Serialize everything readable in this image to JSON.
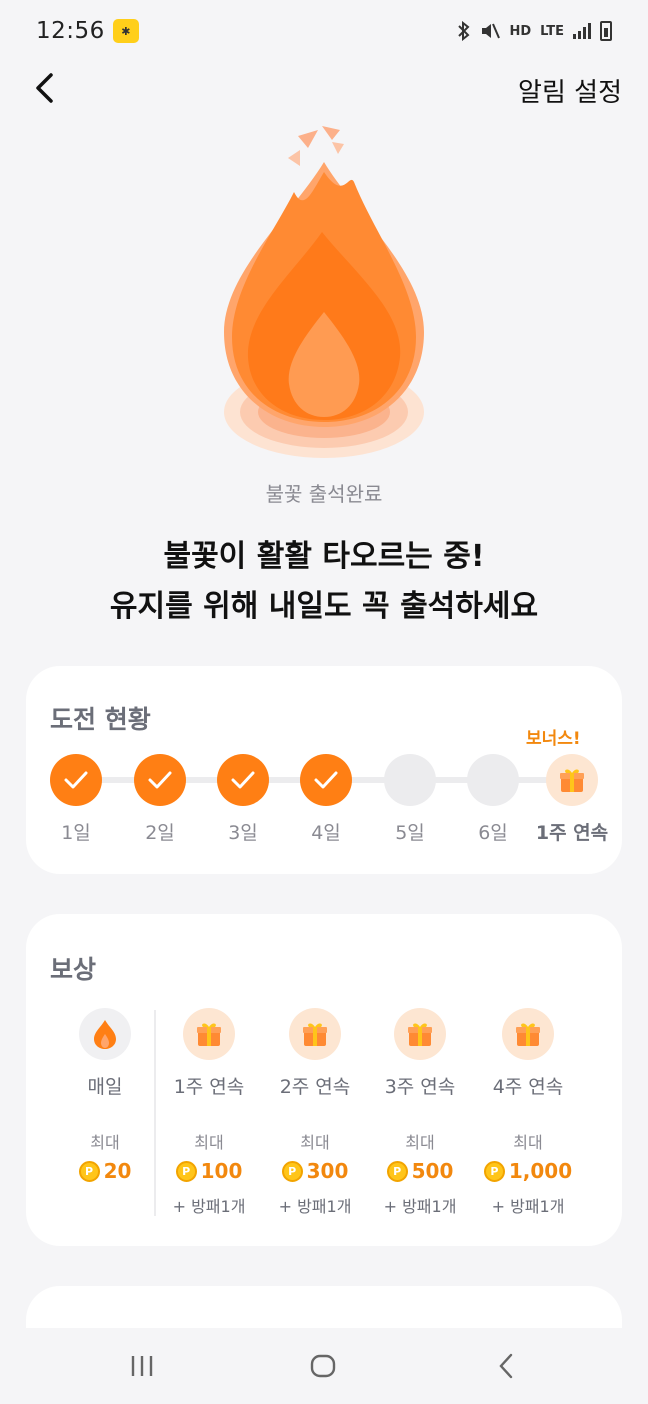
{
  "status_bar": {
    "time": "12:56",
    "indicators": [
      "bluetooth-icon",
      "mute-icon",
      "HD",
      "LTE",
      "signal-icon",
      "battery-icon"
    ],
    "hd_label": "HD",
    "lte_label": "LTE"
  },
  "nav": {
    "alarm_settings": "알림 설정"
  },
  "hero": {
    "caption": "불꽃 출석완료",
    "headline_line1": "불꽃이 활활 타오르는 중!",
    "headline_line2": "유지를 위해 내일도 꼭 출석하세요",
    "flame_color": "#ff7f14"
  },
  "challenge": {
    "title": "도전 현황",
    "bonus_label": "보너스!",
    "days": [
      {
        "label": "1일",
        "status": "done"
      },
      {
        "label": "2일",
        "status": "done"
      },
      {
        "label": "3일",
        "status": "done"
      },
      {
        "label": "4일",
        "status": "done"
      },
      {
        "label": "5일",
        "status": "todo"
      },
      {
        "label": "6일",
        "status": "todo"
      },
      {
        "label": "1주 연속",
        "status": "gift"
      }
    ]
  },
  "rewards": {
    "title": "보상",
    "items": [
      {
        "name": "매일",
        "max": "최대",
        "amount": "20",
        "extra": ""
      },
      {
        "name": "1주 연속",
        "max": "최대",
        "amount": "100",
        "extra": "+ 방패1개"
      },
      {
        "name": "2주 연속",
        "max": "최대",
        "amount": "300",
        "extra": "+ 방패1개"
      },
      {
        "name": "3주 연속",
        "max": "최대",
        "amount": "500",
        "extra": "+ 방패1개"
      },
      {
        "name": "4주 연속",
        "max": "최대",
        "amount": "1,000",
        "extra": "+ 방패1개"
      }
    ],
    "coin_symbol": "P"
  },
  "colors": {
    "accent": "#ff7f14",
    "bonus": "#f2880e",
    "background": "#f5f5f7"
  }
}
